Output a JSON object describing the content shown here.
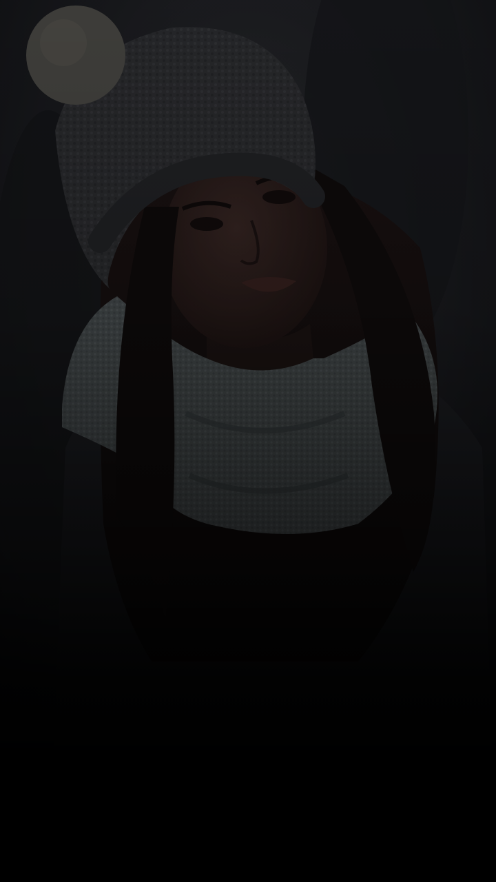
{
  "screen": {
    "background_color": "#000000",
    "overlay_color": "#000000"
  },
  "photo": {
    "subject_icon": "woman-portrait-winter-hat-icon",
    "palette": {
      "background": "#1a1b1e",
      "hat": "#2c2d30",
      "pompom": "#4b4a46",
      "scarf": "#4a5052",
      "skin": "#2a1c1a",
      "hair": "#120d0d",
      "coat": "#17181b"
    }
  }
}
